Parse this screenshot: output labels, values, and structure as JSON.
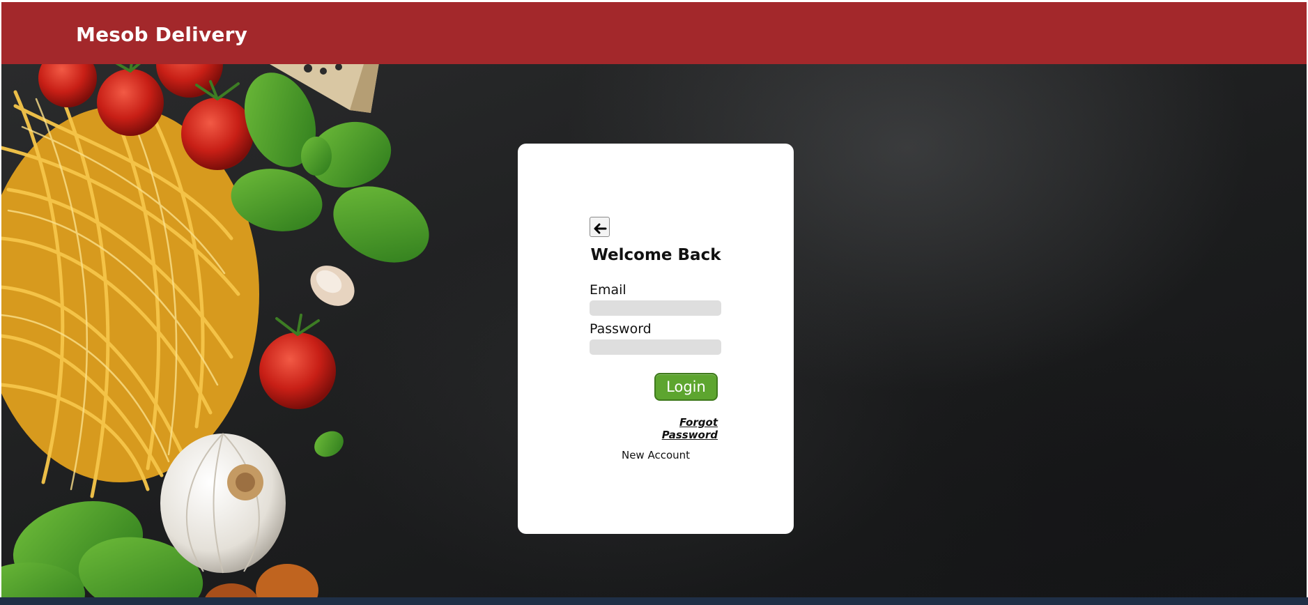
{
  "header": {
    "brand": "Mesob Delivery",
    "background_color": "#a3282b"
  },
  "background": {
    "image": "dark stone surface with pasta, tomatoes, basil and garlic"
  },
  "login_card": {
    "back_icon": "arrow-left-icon",
    "title": "Welcome Back",
    "email": {
      "label": "Email",
      "value": "",
      "placeholder": ""
    },
    "password": {
      "label": "Password",
      "value": "",
      "placeholder": ""
    },
    "login_label": "Login",
    "login_color": "#5da52f",
    "forgot_password_label": "Forgot Password",
    "new_account_label": "New Account"
  }
}
